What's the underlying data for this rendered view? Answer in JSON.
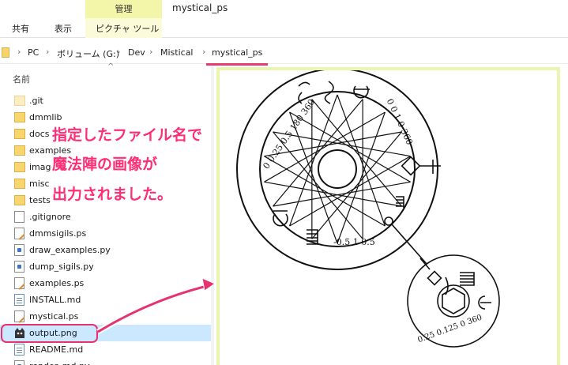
{
  "ribbon": {
    "context_tab": "管理",
    "window_title": "mystical_ps",
    "tabs": [
      "共有",
      "表示",
      "ピクチャ ツール"
    ]
  },
  "address": {
    "crumbs": [
      "PC",
      "ボリューム (G:)",
      "Dev",
      "Mistical",
      "mystical_ps"
    ]
  },
  "list": {
    "column_header": "名前",
    "files": [
      {
        "name": ".git",
        "type": "folder-pale"
      },
      {
        "name": "dmmlib",
        "type": "folder"
      },
      {
        "name": "docs",
        "type": "folder"
      },
      {
        "name": "examples",
        "type": "folder"
      },
      {
        "name": "images",
        "type": "folder"
      },
      {
        "name": "misc",
        "type": "folder"
      },
      {
        "name": "tests",
        "type": "folder"
      },
      {
        "name": ".gitignore",
        "type": "doc"
      },
      {
        "name": "dmmsigils.ps",
        "type": "ps"
      },
      {
        "name": "draw_examples.py",
        "type": "py"
      },
      {
        "name": "dump_sigils.py",
        "type": "py"
      },
      {
        "name": "examples.ps",
        "type": "ps"
      },
      {
        "name": "INSTALL.md",
        "type": "md"
      },
      {
        "name": "mystical.ps",
        "type": "ps"
      },
      {
        "name": "output.png",
        "type": "png"
      },
      {
        "name": "README.md",
        "type": "md"
      },
      {
        "name": "render_md.py",
        "type": "py"
      }
    ]
  },
  "annotation": {
    "line1": "指定したファイル名で",
    "line2": "魔法陣の画像が",
    "line3": "出力されました。",
    "color": "#ff2d75"
  },
  "preview": {
    "big_circle_text": [
      "0 0.25 0.5 180 360",
      "0 0 1 0 360",
      "-0.5 1 0.5"
    ],
    "small_circle_text": [
      "0.25 0.125 0 360"
    ]
  },
  "icons": {
    "folder": "folder-icon",
    "png": "image-file-icon",
    "py": "python-file-icon",
    "ps": "postscript-file-icon",
    "md": "markdown-file-icon"
  }
}
